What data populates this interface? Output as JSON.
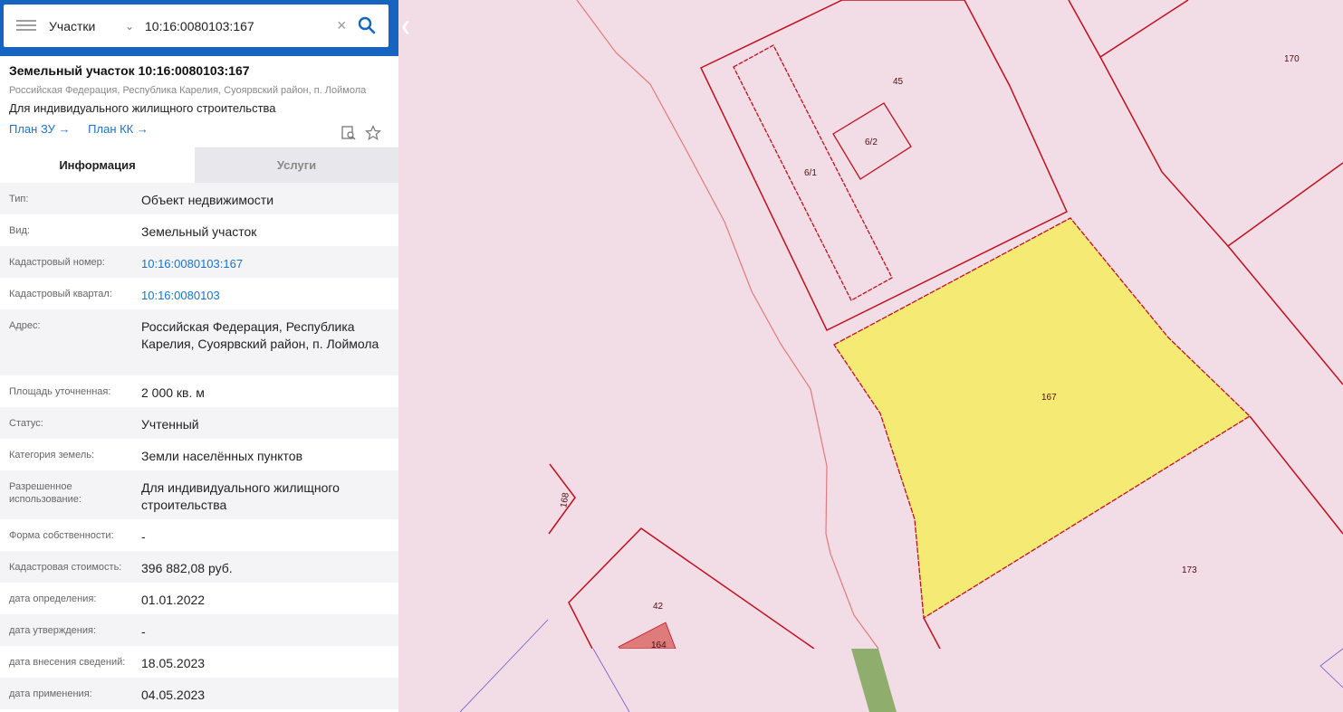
{
  "search": {
    "layer": "Участки",
    "value": "10:16:0080103:167",
    "clear_symbol": "×"
  },
  "card": {
    "title": "Земельный участок 10:16:0080103:167",
    "address": "Российская Федерация, Республика Карелия, Суоярвский район, п. Лоймола",
    "usage": "Для индивидуального жилищного строительства",
    "plan_zu": "План ЗУ →",
    "plan_kk": "План КК →"
  },
  "tabs": {
    "info": "Информация",
    "services": "Услуги"
  },
  "rows": [
    {
      "label": "Тип:",
      "value": "Объект недвижимости"
    },
    {
      "label": "Вид:",
      "value": "Земельный участок"
    },
    {
      "label": "Кадастровый номер:",
      "value": "10:16:0080103:167"
    },
    {
      "label": "Кадастровый квартал:",
      "value": "10:16:0080103"
    },
    {
      "label": "Адрес:",
      "value": "Российская Федерация, Республика Карелия, Суоярвский район, п. Лоймола"
    },
    {
      "label": "Площадь уточненная:",
      "value": "2 000 кв. м"
    },
    {
      "label": "Статус:",
      "value": "Учтенный"
    },
    {
      "label": "Категория земель:",
      "value": "Земли населённых пунктов"
    },
    {
      "label": "Разрешенное использование:",
      "value": "Для индивидуального жилищного строительства"
    },
    {
      "label": "Форма собственности:",
      "value": "-"
    },
    {
      "label": "Кадастровая стоимость:",
      "value": "396 882,08 руб."
    },
    {
      "label": "дата определения:",
      "value": "01.01.2022"
    },
    {
      "label": "дата утверждения:",
      "value": "-"
    },
    {
      "label": "дата внесения сведений:",
      "value": "18.05.2023"
    },
    {
      "label": "дата применения:",
      "value": "04.05.2023"
    }
  ],
  "map_labels": {
    "p170": "170",
    "p45": "45",
    "p6_2": "6/2",
    "p6_1": "6/1",
    "p167": "167",
    "p168": "168",
    "p42": "42",
    "p164": "164",
    "p173": "173"
  },
  "colors": {
    "accent": "#1565c0",
    "map_background": "#f2dce6",
    "parcel_border": "#c0101c",
    "selected_fill": "#f5ea73",
    "link": "#1a73c8"
  },
  "icons": {
    "menu": "menu-icon",
    "dropdown": "chevron-down-icon",
    "clear": "close-icon",
    "search": "search-icon",
    "collapse": "chevron-left-icon",
    "print_search": "document-search-icon",
    "favorite": "star-icon"
  }
}
